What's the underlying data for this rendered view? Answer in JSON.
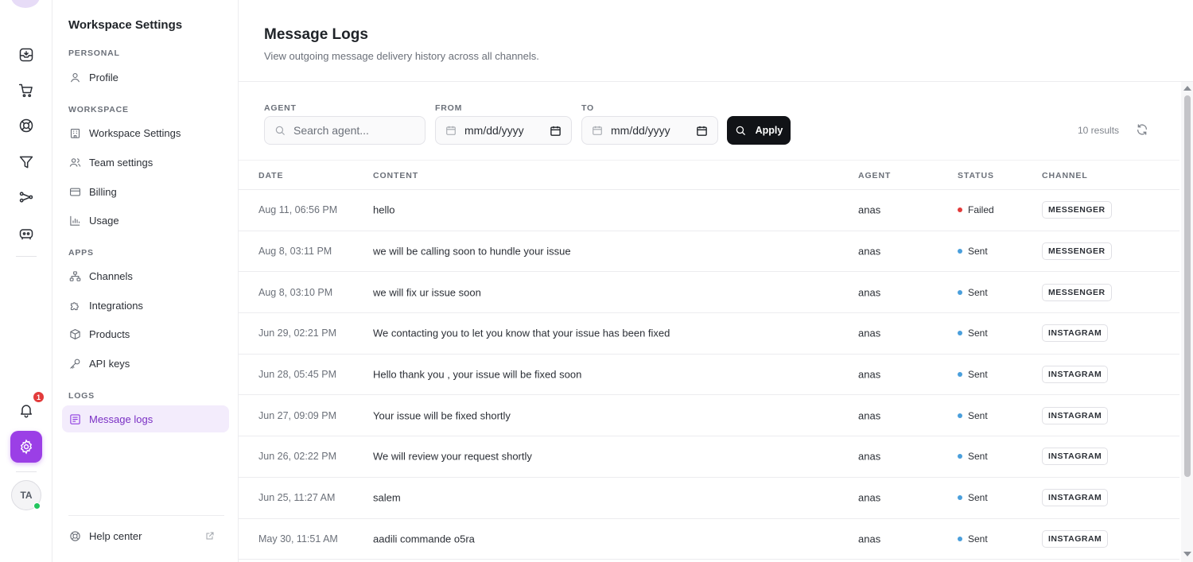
{
  "rail": {
    "notification_count": "1",
    "avatar_initials": "TA",
    "accent_color": "#9b3fe6"
  },
  "sidebar": {
    "title": "Workspace Settings",
    "sections": {
      "personal": "PERSONAL",
      "workspace": "WORKSPACE",
      "apps": "APPS",
      "logs": "LOGS"
    },
    "items": {
      "profile": "Profile",
      "workspace_settings": "Workspace Settings",
      "team_settings": "Team settings",
      "billing": "Billing",
      "usage": "Usage",
      "channels": "Channels",
      "integrations": "Integrations",
      "products": "Products",
      "api_keys": "API keys",
      "message_logs": "Message logs"
    },
    "help": "Help center"
  },
  "main": {
    "title": "Message Logs",
    "subtitle": "View outgoing message delivery history across all channels."
  },
  "filters": {
    "agent_label": "AGENT",
    "agent_placeholder": "Search agent...",
    "from_label": "FROM",
    "from_value": "mm/dd/yyyy",
    "to_label": "TO",
    "to_value": "mm/dd/yyyy",
    "apply_label": "Apply",
    "results_text": "10 results"
  },
  "table": {
    "columns": {
      "date": "DATE",
      "content": "CONTENT",
      "agent": "AGENT",
      "status": "STATUS",
      "channel": "CHANNEL"
    },
    "status_colors": {
      "Failed": "#e23b3b",
      "Sent": "#4a9fdc"
    },
    "rows": [
      {
        "date": "Aug 11, 06:56 PM",
        "content": "hello",
        "agent": "anas",
        "status": "Failed",
        "channel": "MESSENGER"
      },
      {
        "date": "Aug 8, 03:11 PM",
        "content": "we will be calling soon to hundle your issue",
        "agent": "anas",
        "status": "Sent",
        "channel": "MESSENGER"
      },
      {
        "date": "Aug 8, 03:10 PM",
        "content": "we will fix ur issue soon",
        "agent": "anas",
        "status": "Sent",
        "channel": "MESSENGER"
      },
      {
        "date": "Jun 29, 02:21 PM",
        "content": "We contacting you to let you know that your issue has been fixed",
        "agent": "anas",
        "status": "Sent",
        "channel": "INSTAGRAM"
      },
      {
        "date": "Jun 28, 05:45 PM",
        "content": "Hello thank you , your issue will be fixed soon",
        "agent": "anas",
        "status": "Sent",
        "channel": "INSTAGRAM"
      },
      {
        "date": "Jun 27, 09:09 PM",
        "content": "Your issue will be fixed shortly",
        "agent": "anas",
        "status": "Sent",
        "channel": "INSTAGRAM"
      },
      {
        "date": "Jun 26, 02:22 PM",
        "content": "We will review your request shortly",
        "agent": "anas",
        "status": "Sent",
        "channel": "INSTAGRAM"
      },
      {
        "date": "Jun 25, 11:27 AM",
        "content": "salem",
        "agent": "anas",
        "status": "Sent",
        "channel": "INSTAGRAM"
      },
      {
        "date": "May 30, 11:51 AM",
        "content": "aadili commande o5ra",
        "agent": "anas",
        "status": "Sent",
        "channel": "INSTAGRAM"
      }
    ]
  }
}
